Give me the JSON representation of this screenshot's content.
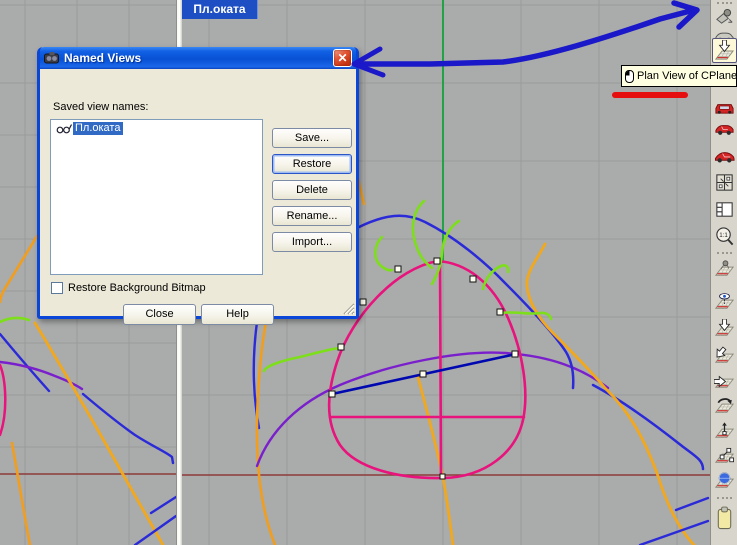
{
  "viewport": {
    "tab_label": "Пл.оката",
    "left_viewport_name": "left-viewport",
    "right_viewport_name": "right-viewport"
  },
  "dialog": {
    "title": "Named Views",
    "close_glyph": "✕",
    "saved_views_label": "Saved view names:",
    "list": {
      "items": [
        {
          "icon": "eyeglasses-icon",
          "label": "Пл.оката",
          "selected": true
        }
      ]
    },
    "buttons": {
      "save": "Save...",
      "restore": "Restore",
      "delete": "Delete",
      "rename": "Rename...",
      "import": "Import..."
    },
    "checkbox": {
      "label": "Restore Background Bitmap",
      "checked": false
    },
    "close": "Close",
    "help": "Help"
  },
  "tooltip": {
    "icon": "mouse-left-button-icon",
    "text": "Plan View of CPlane"
  },
  "toolbar": {
    "zoom_label": "1:1",
    "pressed_item": "plan-view-cplane-button",
    "icons": [
      "grip-dots",
      "shade-lamp-icon",
      "car-gray-icon",
      "plan-view-cplane-icon",
      "car-red-front-icon",
      "car-red-side-icon",
      "car-red-sports-icon",
      "four-viewports-icon",
      "viewport-layout-icon",
      "zoom-1to1-icon",
      "grip-dots",
      "cplane-shade-icon",
      "cplane-view-icon",
      "cplane-origin-icon",
      "cplane-corner-icon",
      "cplane-right-icon",
      "cplane-rotate-icon",
      "cplane-elevate-icon",
      "cplane-object-icon",
      "cplane-world-icon",
      "grip-dots",
      "paste-clipboard-icon"
    ]
  },
  "annotations": {
    "blue_arrow_color": "#1a18c8",
    "red_line_color": "#e60f0f"
  },
  "colors": {
    "viewport_bg": "#aaabab",
    "grid_line": "#9b9b9b",
    "axis_green": "#12a23b",
    "axis_maroon": "#8e3a3a",
    "curve_magenta": "#e8137c",
    "curve_navy": "#0008b0",
    "curve_blue": "#2a2ad8",
    "curve_purple": "#7a1fcc",
    "curve_orange": "#f29e1c",
    "curve_green": "#7ddf1a",
    "selection_blue": "#316ac5",
    "dialog_face": "#ece9d8",
    "tab_blue": "#1e4ec4",
    "tooltip_bg": "#ffffe1"
  }
}
